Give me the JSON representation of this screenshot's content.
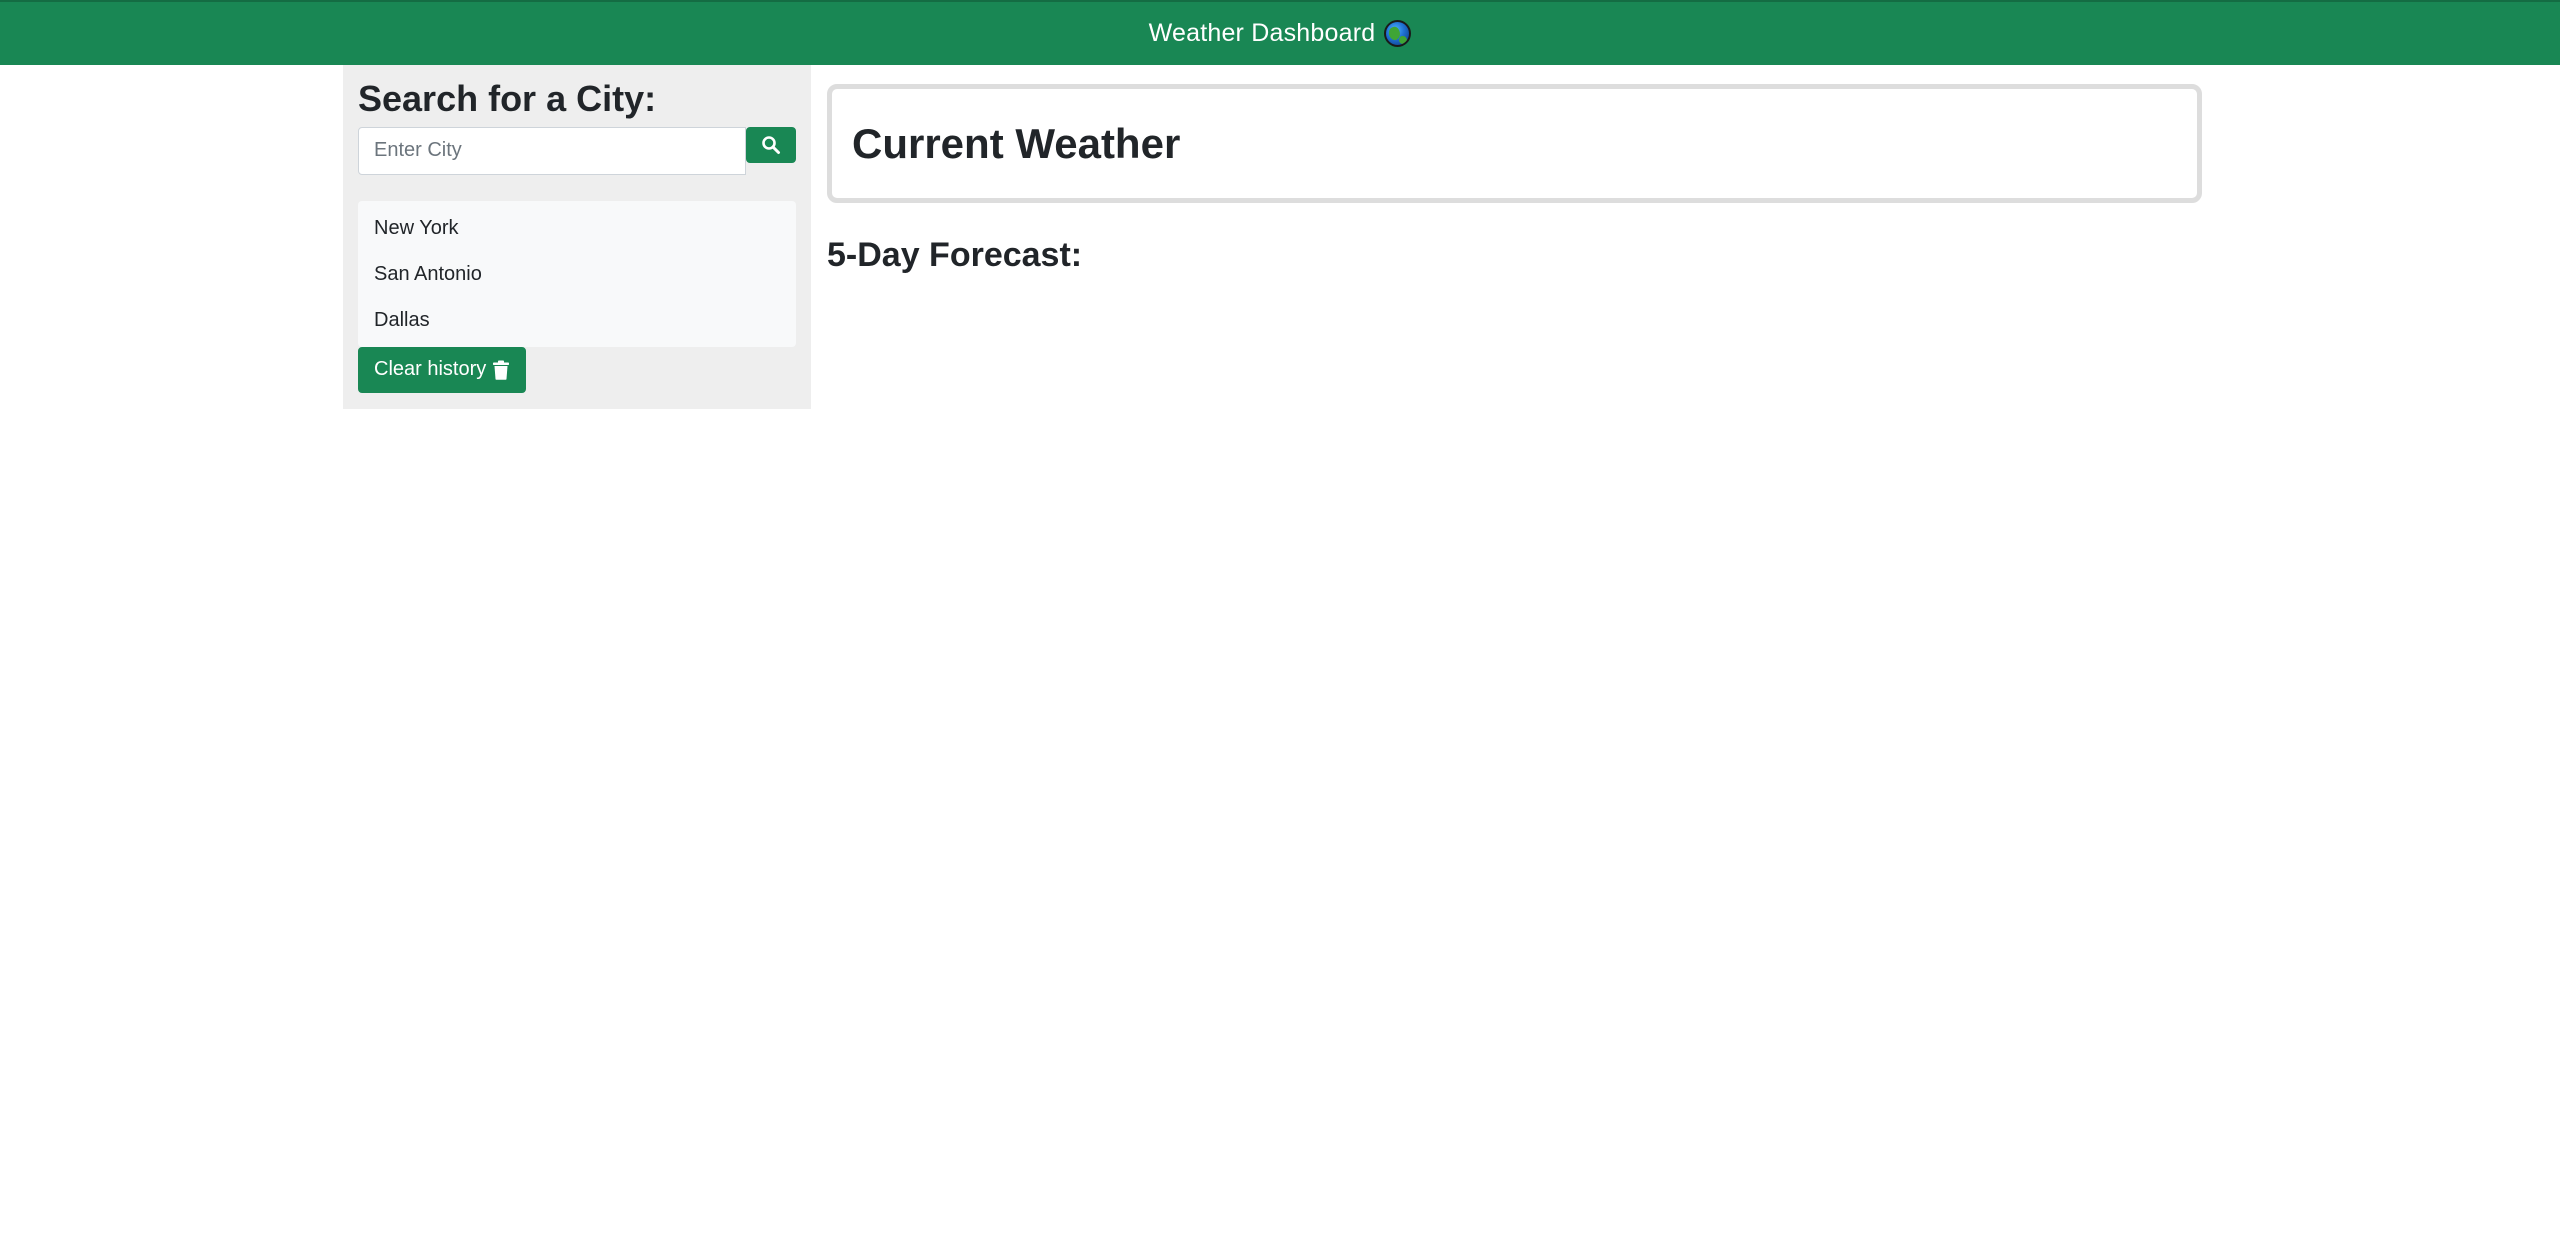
{
  "header": {
    "title": "Weather Dashboard",
    "icon": "globe-icon",
    "background": "#198754"
  },
  "sidebar": {
    "heading": "Search for a City:",
    "search": {
      "placeholder": "Enter City",
      "value": "",
      "button_icon": "search-icon"
    },
    "history": [
      {
        "label": "New York"
      },
      {
        "label": "San Antonio"
      },
      {
        "label": "Dallas"
      }
    ],
    "clear_button": {
      "label": "Clear history",
      "icon": "trash-icon"
    }
  },
  "main": {
    "current_weather_title": "Current Weather",
    "forecast_title": "5-Day Forecast:"
  },
  "colors": {
    "accent": "#198754",
    "sidebar_bg": "#eeeeee",
    "history_bg": "#f8f9fa",
    "card_border": "#dddddd"
  }
}
